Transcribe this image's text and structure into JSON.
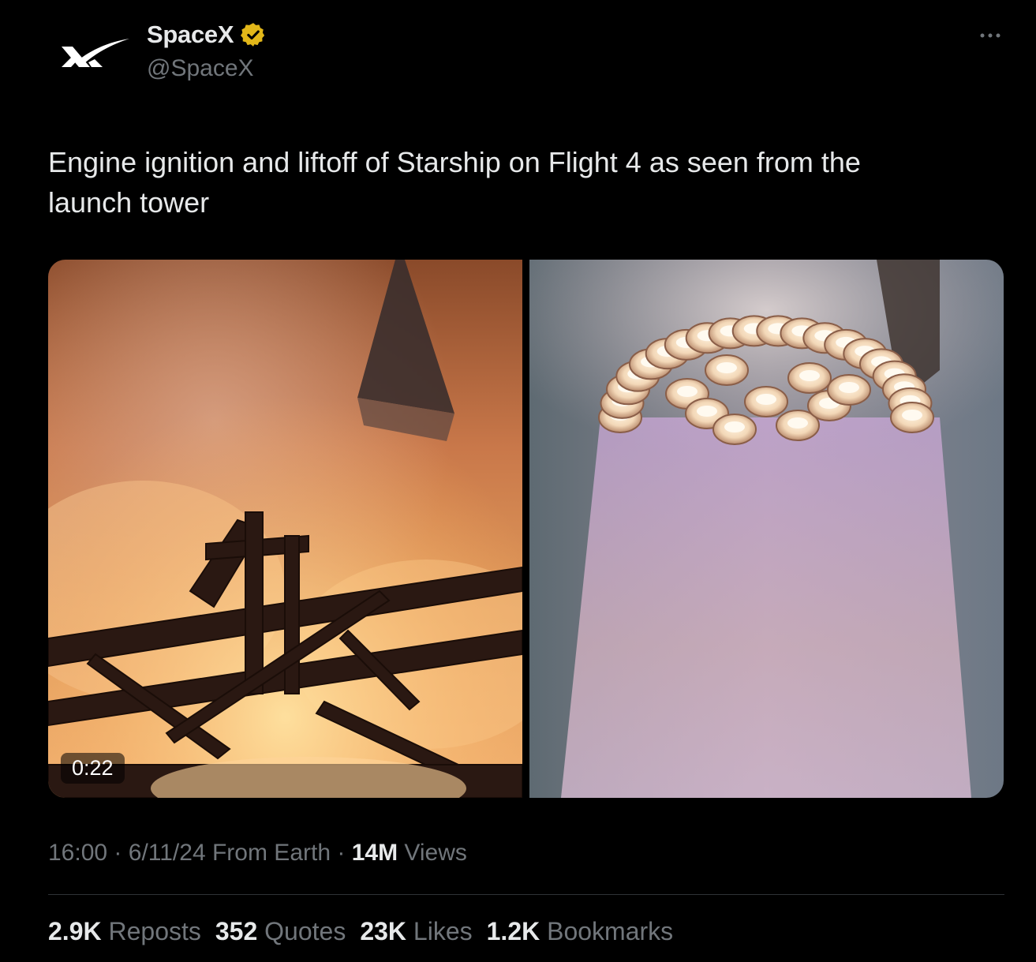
{
  "author": {
    "name": "SpaceX",
    "handle": "@SpaceX",
    "verified_badge_color": "#e2b719"
  },
  "tweet": {
    "text": "Engine ignition and liftoff of Starship on Flight 4 as seen from the launch tower"
  },
  "media": {
    "video_duration": "0:22"
  },
  "meta": {
    "time": "16:00",
    "separator": "·",
    "date": "6/11/24",
    "source": "From Earth",
    "views_count": "14M",
    "views_label": "Views"
  },
  "stats": {
    "reposts_count": "2.9K",
    "reposts_label": "Reposts",
    "quotes_count": "352",
    "quotes_label": "Quotes",
    "likes_count": "23K",
    "likes_label": "Likes",
    "bookmarks_count": "1.2K",
    "bookmarks_label": "Bookmarks"
  },
  "icons": {
    "avatar": "spacex-logo-icon",
    "verified": "verified-badge-icon",
    "more": "more-options-icon"
  },
  "colors": {
    "background": "#000000",
    "primary_text": "#e7e9ea",
    "secondary_text": "#71767b",
    "divider": "#2f3336"
  }
}
